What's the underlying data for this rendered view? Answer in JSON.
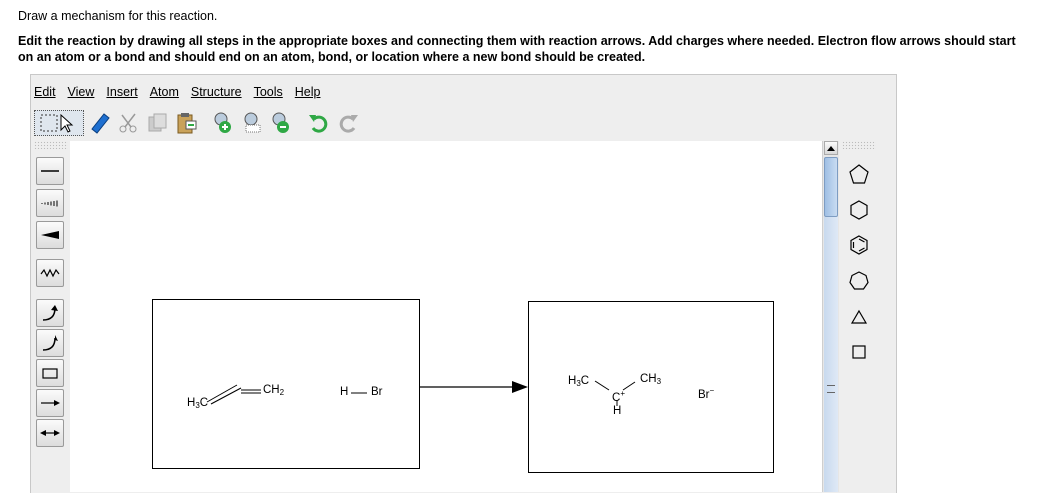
{
  "instructions": {
    "line1": "Draw a mechanism for this reaction.",
    "line2": "Edit the reaction by drawing all steps in the appropriate boxes and connecting them with reaction arrows. Add charges where needed. Electron flow arrows should start on an atom or a bond and should end on an atom, bond, or location where a new bond should be created."
  },
  "menu": {
    "items": [
      "Edit",
      "View",
      "Insert",
      "Atom",
      "Structure",
      "Tools",
      "Help"
    ]
  },
  "toolbar": {
    "icons": [
      "select-lasso-icon",
      "eraser-icon",
      "cut-icon",
      "copy-icon",
      "paste-icon",
      "zoom-in-icon",
      "zoom-fit-icon",
      "zoom-out-icon",
      "undo-icon",
      "redo-icon"
    ]
  },
  "left_tools": [
    "single-bond-icon",
    "hashed-bond-icon",
    "wedge-bond-icon",
    "wavy-bond-icon",
    "curved-arrow-icon",
    "half-curved-arrow-icon",
    "rectangle-box-icon",
    "reaction-arrow-icon",
    "double-arrow-icon"
  ],
  "right_tools": [
    "cyclopentane-icon",
    "cyclohexane-icon",
    "benzene-icon",
    "cycloheptane-icon",
    "cyclopropane-icon",
    "cyclobutane-icon"
  ],
  "reactants": {
    "h3c": "H",
    "h3c_sub": "3",
    "h3c_c": "C",
    "ch2": "CH",
    "ch2_sub": "2",
    "h": "H",
    "br": "Br"
  },
  "products": {
    "h3c": "H",
    "h3c_sub": "3",
    "h3c_c": "C",
    "ch3": "CH",
    "ch3_sub": "3",
    "cplus": "C",
    "cplus_charge": "+",
    "h": "H",
    "br": "Br",
    "br_charge": "−"
  },
  "colors": {
    "eraser": "#1e6fd0",
    "zoom_in": "#2fa845",
    "zoom_out": "#2fa845",
    "undo": "#2fa845"
  }
}
